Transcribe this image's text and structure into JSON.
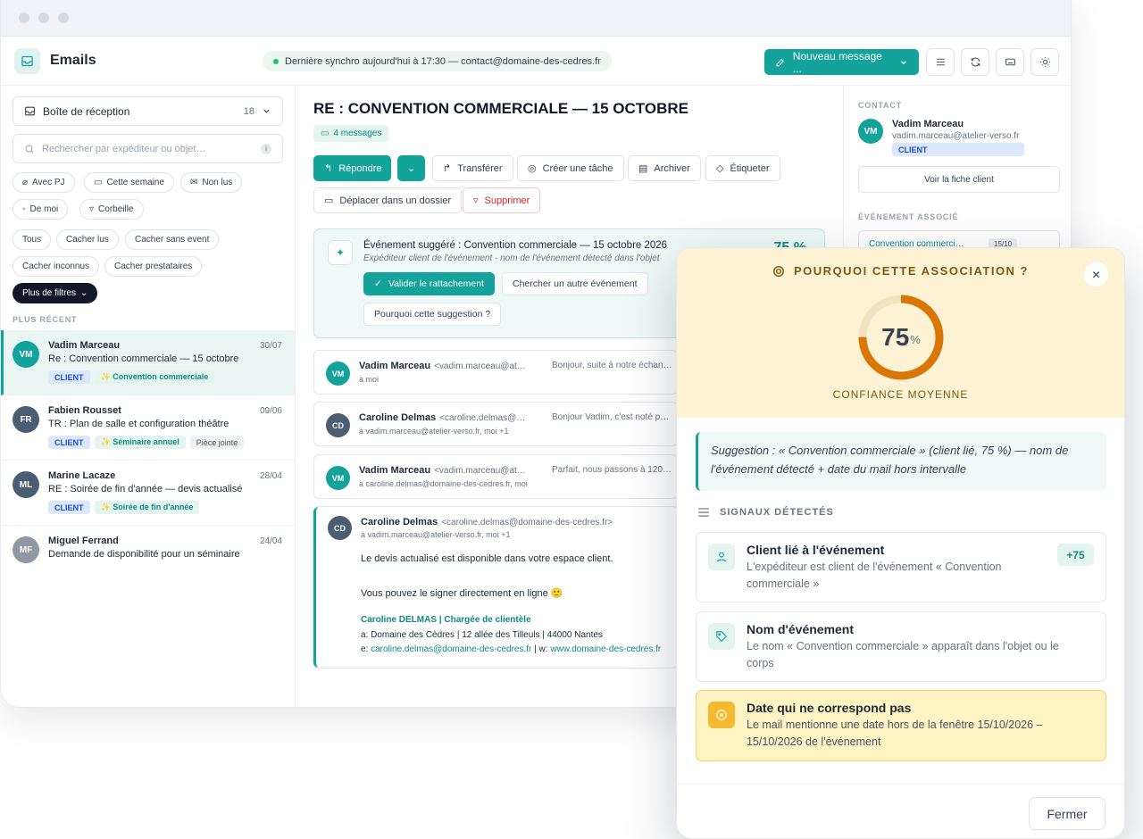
{
  "app": {
    "title": "Emails",
    "sync": "Dernière synchro aujourd'hui à 17:30 — contact@domaine-des-cedres.fr",
    "new_message": "Nouveau message ...",
    "accent": "#14a39a"
  },
  "sidebar": {
    "mailbox": "Boîte de réception",
    "mailbox_count": "18",
    "search_placeholder": "Rechercher par expéditeur ou objet…",
    "filters_row1": [
      "Avec PJ",
      "Cette semaine",
      "Non lus"
    ],
    "filters_row2": [
      "De moi",
      "Corbeille"
    ],
    "filters_row3": [
      "Tous",
      "Cacher lus",
      "Cacher sans event"
    ],
    "filters_row4": [
      "Cacher inconnus",
      "Cacher prestataires"
    ],
    "more_filters": "Plus de filtres",
    "section": "PLUS RÉCENT",
    "mails": [
      {
        "initials": "VM",
        "from": "Vadim Marceau",
        "date": "30/07",
        "subject": "Re : Convention commerciale — 15 octobre",
        "tag1": "CLIENT",
        "tag2": "✨ Convention commerciale",
        "tag3": ""
      },
      {
        "initials": "FR",
        "from": "Fabien Rousset",
        "date": "09/06",
        "subject": "TR : Plan de salle et configuration théâtre",
        "tag1": "CLIENT",
        "tag2": "✨ Séminaire annuel",
        "tag3": "Pièce jointe"
      },
      {
        "initials": "ML",
        "from": "Marine Lacaze",
        "date": "28/04",
        "subject": "RE : Soirée de fin d'année — devis actualisé",
        "tag1": "CLIENT",
        "tag2": "✨ Soirée de fin d'année",
        "tag3": ""
      },
      {
        "initials": "MF",
        "from": "Miguel Ferrand",
        "date": "24/04",
        "subject": "Demande de disponibilité pour un séminaire",
        "tag1": "",
        "tag2": "",
        "tag3": ""
      }
    ]
  },
  "main": {
    "subject": "RE : CONVENTION COMMERCIALE — 15 OCTOBRE",
    "message_count": "4 messages",
    "actions": {
      "reply": "Répondre",
      "forward": "Transférer",
      "task": "Créer une tâche",
      "archive": "Archiver",
      "label": "Étiqueter",
      "move": "Déplacer dans un dossier",
      "delete": "Supprimer"
    },
    "suggestion": {
      "title": "Événement suggéré : Convention commerciale — 15 octobre 2026",
      "subtitle": "Expéditeur client de l'événement · nom de l'événement détecté dans l'objet",
      "pct": "75 %",
      "validate": "Valider le rattachement",
      "search_other": "Chercher un autre événement",
      "why": "Pourquoi cette suggestion ?"
    },
    "thread": [
      {
        "initials": "VM",
        "from": "Vadim Marceau",
        "addr": "<vadim.marceau@at…",
        "to": "à moi",
        "snippet": "Bonjour, suite à notre échan…"
      },
      {
        "initials": "CD",
        "from": "Caroline Delmas",
        "addr": "<caroline.delmas@…",
        "to": "à vadim.marceau@atelier-verso.fr, moi +1",
        "snippet": "Bonjour Vadim, c'est noté p…"
      },
      {
        "initials": "VM",
        "from": "Vadim Marceau",
        "addr": "<vadim.marceau@at…",
        "to": "à caroline.delmas@domaine-des-cedres.fr, moi",
        "snippet": "Parfait, nous passons à 120…"
      }
    ],
    "open": {
      "initials": "CD",
      "from": "Caroline Delmas",
      "addr": "<caroline.delmas@domaine-des-cedres.fr>",
      "to": "à vadim.marceau@atelier-verso.fr, moi +1",
      "line1": "Le devis actualisé est disponible dans votre espace client.",
      "line2": "Vous pouvez le signer directement en ligne 🙂",
      "sig_name": "Caroline DELMAS | Chargée de clientèle",
      "sig_addr": "a: Domaine des Cèdres | 12 allée des Tilleuls | 44000 Nantes",
      "sig_e": "e:",
      "sig_email": "caroline.delmas@domaine-des-cedres.fr",
      "sig_w": "| w:",
      "sig_web": "www.domaine-des-cedres.fr"
    }
  },
  "contact": {
    "label": "CONTACT",
    "initials": "VM",
    "name": "Vadim Marceau",
    "email": "vadim.marceau@atelier-verso.fr",
    "badge": "CLIENT",
    "button": "Voir la fiche client",
    "event_label": "ÉVÉNEMENT ASSOCIÉ",
    "event_name": "Convention commerci…",
    "event_badge": "15/10"
  },
  "modal": {
    "title": "POURQUOI CETTE ASSOCIATION ?",
    "confidence": 75,
    "pct_sign": "%",
    "confidence_label": "CONFIANCE MOYENNE",
    "quote": "Suggestion : « Convention commerciale » (client lié, 75 %) — nom de l'événement détecté + date du mail hors intervalle",
    "signals_label": "SIGNAUX DÉTECTÉS",
    "signals": [
      {
        "title": "Client lié à l'événement",
        "desc": "L'expéditeur est client de l'événement « Convention commerciale »",
        "score": "+75"
      },
      {
        "title": "Nom d'événement",
        "desc": "Le nom « Convention commerciale » apparaît dans l'objet ou le corps",
        "score": ""
      },
      {
        "title": "Date qui ne correspond pas",
        "desc": "Le mail mentionne une date hors de la fenêtre 15/10/2026 – 15/10/2026 de l'événement",
        "score": ""
      }
    ],
    "close": "Fermer"
  }
}
